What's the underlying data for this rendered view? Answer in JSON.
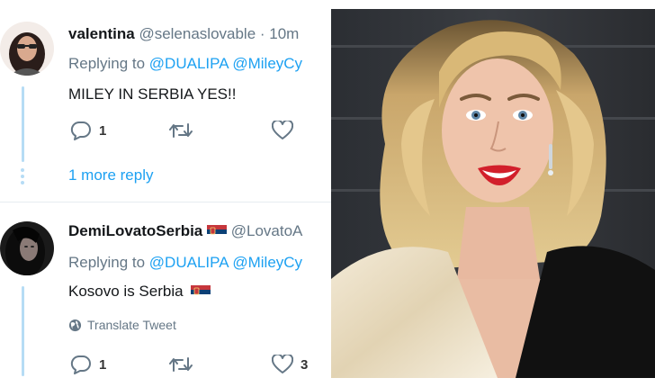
{
  "tweet1": {
    "display_name": "valentina",
    "handle_time": "@selenaslovable · 10m",
    "replying_prefix": "Replying to",
    "mentions": [
      "@DUALIPA",
      "@MileyCy"
    ],
    "text": "MILEY IN SERBIA YES!!",
    "reply_count": "1",
    "retweet_count": "",
    "like_count": ""
  },
  "more_replies": {
    "label": "1 more reply"
  },
  "tweet2": {
    "display_name": "DemiLovatoSerbia",
    "handle": "@LovatoA",
    "replying_prefix": "Replying to",
    "mentions": [
      "@DUALIPA",
      "@MileyCy"
    ],
    "text": "Kosovo is Serbia",
    "translate_label": "Translate Tweet",
    "reply_count": "1",
    "retweet_count": "",
    "like_count": "3"
  },
  "icons": {
    "reply": "reply-icon",
    "retweet": "retweet-icon",
    "like": "heart-icon",
    "globe": "globe-icon",
    "flag": "serbia-flag-icon"
  },
  "colors": {
    "link": "#1da1f2",
    "muted": "#657786",
    "thread": "#b6dcf5",
    "text": "#14171a"
  }
}
